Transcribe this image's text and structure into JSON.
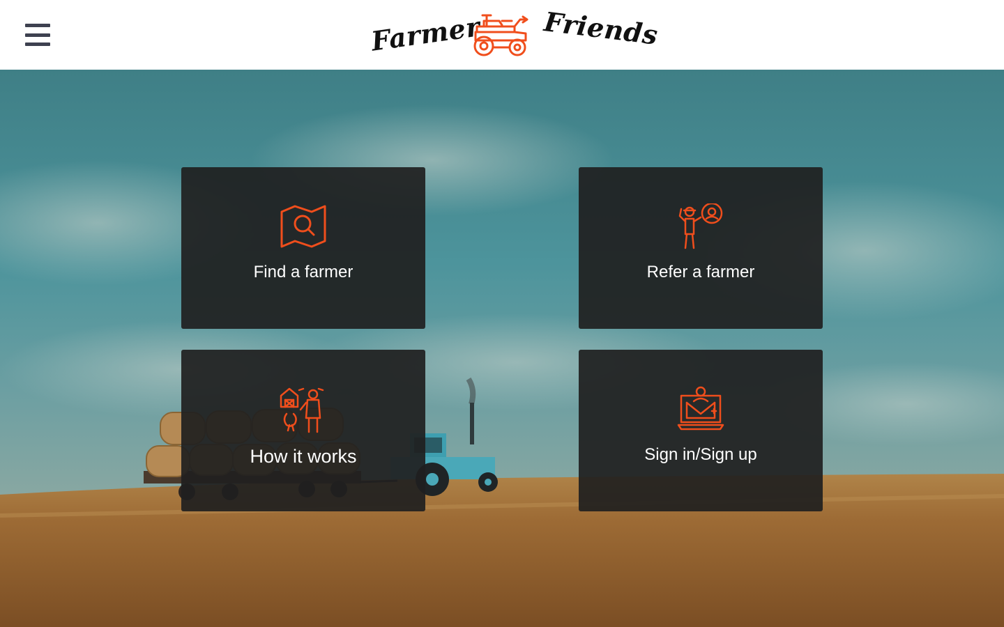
{
  "header": {
    "menu_icon": "hamburger-menu-icon",
    "logo": {
      "word_left": "Farmer",
      "word_right": "Friends",
      "icon": "tractor-icon"
    }
  },
  "colors": {
    "accent": "#f04e1c",
    "card_bg": "#202020",
    "menu_icon": "#3e4150",
    "sky": "#4a8f97",
    "field": "#9c6a34"
  },
  "cards": [
    {
      "label": "Find a farmer",
      "icon": "map-search-icon"
    },
    {
      "label": "Refer a farmer",
      "icon": "farmer-refer-icon"
    },
    {
      "label": "How it works",
      "icon": "farm-workflow-icon"
    },
    {
      "label": "Sign in/Sign up",
      "icon": "laptop-user-icon"
    }
  ]
}
